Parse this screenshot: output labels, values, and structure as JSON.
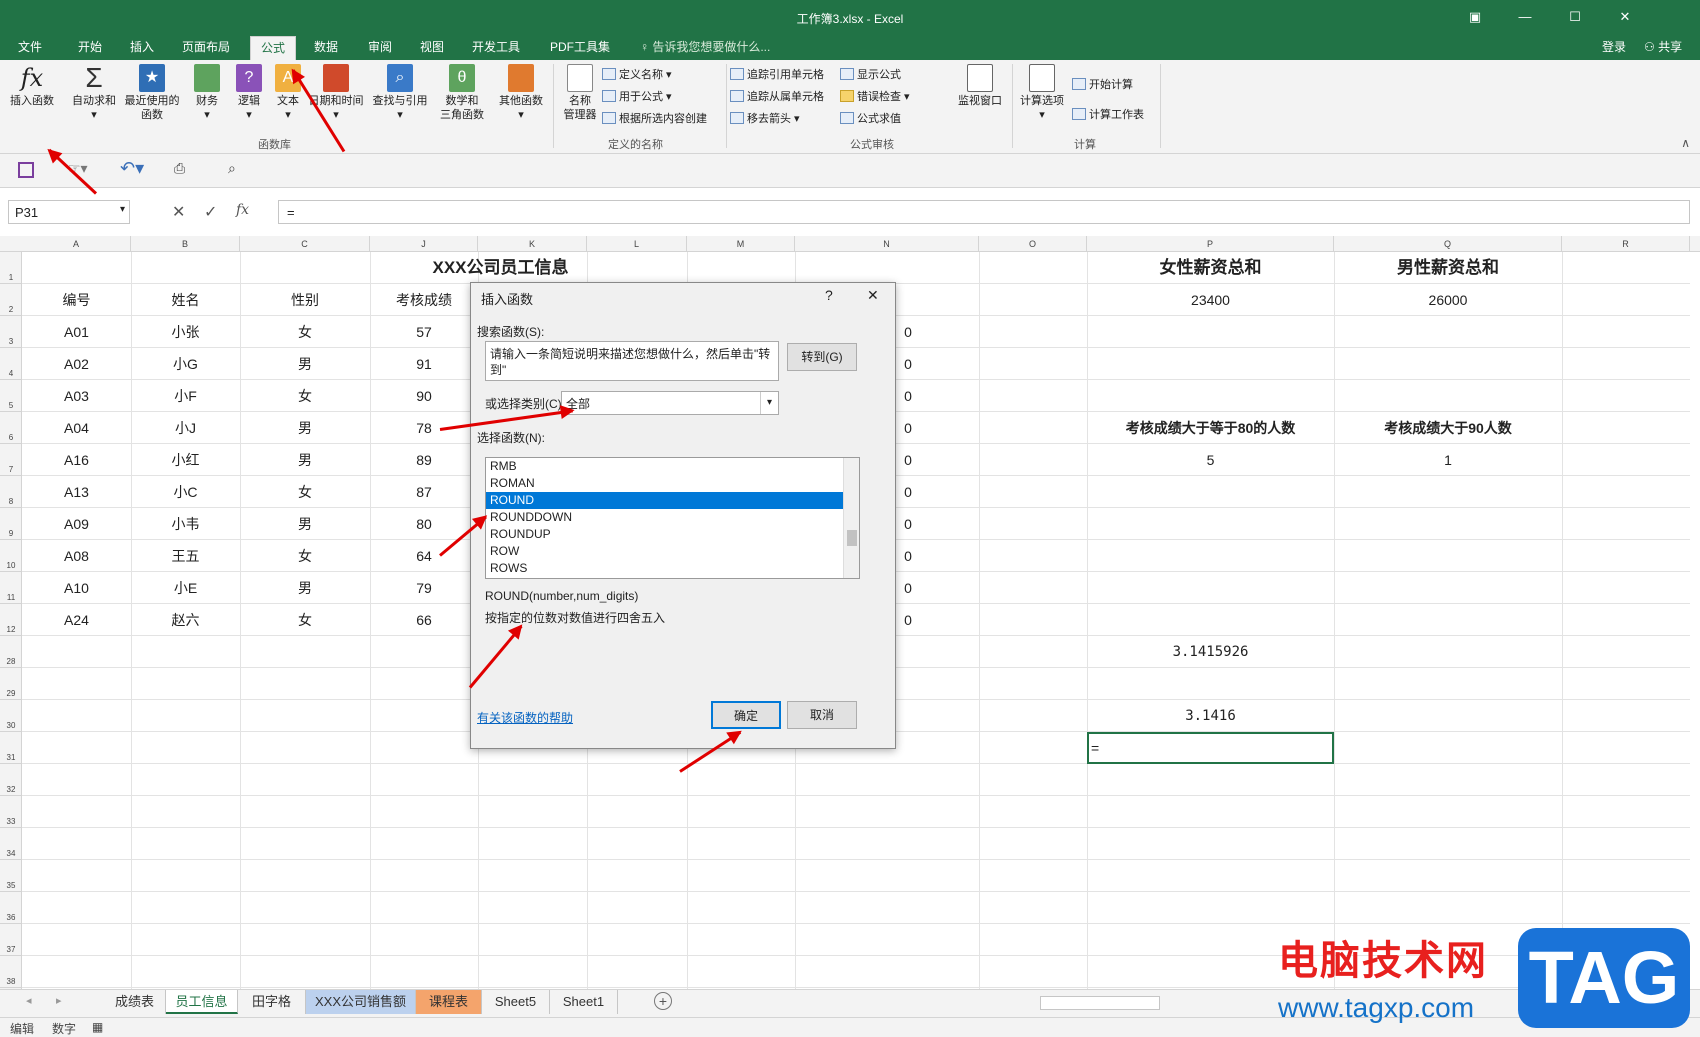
{
  "window": {
    "title": "工作簿3.xlsx - Excel",
    "login": "登录",
    "share": "共享"
  },
  "menu": {
    "tabs": [
      "文件",
      "开始",
      "插入",
      "页面布局",
      "公式",
      "数据",
      "审阅",
      "视图",
      "开发工具",
      "PDF工具集"
    ],
    "active": "公式",
    "tell_me": "告诉我您想要做什么..."
  },
  "ribbon": {
    "insert_function": "插入函数",
    "autosum": "自动求和",
    "recent": "最近使用的\n函数",
    "financial": "财务",
    "logical": "逻辑",
    "text": "文本",
    "datetime": "日期和时间",
    "lookup": "查找与引用",
    "math": "数学和\n三角函数",
    "more": "其他函数",
    "group_library": "函数库",
    "name_manager": "名称\n管理器",
    "define_name": "定义名称",
    "use_in_formula": "用于公式",
    "create_from_sel": "根据所选内容创建",
    "group_names": "定义的名称",
    "trace_precedents": "追踪引用单元格",
    "trace_dependents": "追踪从属单元格",
    "remove_arrows": "移去箭头",
    "show_formulas": "显示公式",
    "error_checking": "错误检查",
    "evaluate": "公式求值",
    "group_audit": "公式审核",
    "watch": "监视窗口",
    "calc_options": "计算选项",
    "calc_now": "开始计算",
    "calc_sheet": "计算工作表",
    "group_calc": "计算"
  },
  "formula_bar": {
    "name_box": "P31",
    "formula": "="
  },
  "columns": [
    "A",
    "B",
    "C",
    "J",
    "K",
    "L",
    "M",
    "N",
    "O",
    "P",
    "Q",
    "R"
  ],
  "rows": [
    "1",
    "2",
    "3",
    "4",
    "5",
    "6",
    "7",
    "8",
    "9",
    "10",
    "11",
    "12",
    "28",
    "29",
    "30",
    "31",
    "32",
    "33",
    "34",
    "35",
    "36",
    "37",
    "38"
  ],
  "sheet": {
    "title": "XXX公司员工信息",
    "headers": [
      "编号",
      "姓名",
      "性别",
      "考核成绩"
    ],
    "data": [
      [
        "A01",
        "小张",
        "女",
        "57"
      ],
      [
        "A02",
        "小G",
        "男",
        "91"
      ],
      [
        "A03",
        "小F",
        "女",
        "90"
      ],
      [
        "A04",
        "小J",
        "男",
        "78"
      ],
      [
        "A16",
        "小红",
        "男",
        "89"
      ],
      [
        "A13",
        "小C",
        "女",
        "87"
      ],
      [
        "A09",
        "小韦",
        "男",
        "80"
      ],
      [
        "A08",
        "王五",
        "女",
        "64"
      ],
      [
        "A10",
        "小E",
        "男",
        "79"
      ],
      [
        "A24",
        "赵六",
        "女",
        "66"
      ]
    ],
    "n_col_values": [
      "0",
      "0",
      "0",
      "0",
      "0",
      "0",
      "0",
      "0",
      "0",
      "0"
    ],
    "p_header": "女性薪资总和",
    "q_header": "男性薪资总和",
    "p_value": "23400",
    "q_value": "26000",
    "p_label2": "考核成绩大于等于80的人数",
    "q_label2": "考核成绩大于90人数",
    "p_value2": "5",
    "q_value2": "1",
    "p28": "3.1415926",
    "p30": "3.1416",
    "p31": "="
  },
  "dialog": {
    "title": "插入函数",
    "help_btn": "?",
    "close_btn": "✕",
    "search_label": "搜索函数(S):",
    "search_text": "请输入一条简短说明来描述您想做什么，然后单击\"转到\"",
    "goto": "转到(G)",
    "category_label": "或选择类别(C):",
    "category_value": "全部",
    "select_label": "选择函数(N):",
    "functions": [
      "RMB",
      "ROMAN",
      "ROUND",
      "ROUNDDOWN",
      "ROUNDUP",
      "ROW",
      "ROWS"
    ],
    "selected": "ROUND",
    "signature": "ROUND(number,num_digits)",
    "description": "按指定的位数对数值进行四舍五入",
    "help_link": "有关该函数的帮助",
    "ok": "确定",
    "cancel": "取消"
  },
  "sheet_tabs": [
    "成绩表",
    "员工信息",
    "田字格",
    "XXX公司销售额",
    "课程表",
    "Sheet5",
    "Sheet1"
  ],
  "active_sheet": "员工信息",
  "status": {
    "mode": "编辑",
    "num": "数字"
  },
  "watermark": {
    "line1": "电脑技术网",
    "line2": "www.tagxp.com",
    "tag": "TAG"
  }
}
